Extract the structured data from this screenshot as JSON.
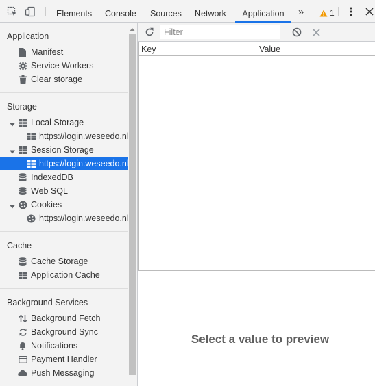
{
  "toolbar": {
    "tabs": [
      "Elements",
      "Console",
      "Sources",
      "Network",
      "Application"
    ],
    "active_tab": "Application",
    "warnings_count": "1",
    "accent": "#1a73e8",
    "warning_color": "#f29900"
  },
  "sidebar": {
    "application": {
      "title": "Application",
      "items": [
        "Manifest",
        "Service Workers",
        "Clear storage"
      ]
    },
    "storage": {
      "title": "Storage",
      "local_storage": "Local Storage",
      "local_storage_origin": "https://login.weseedo.nl",
      "session_storage": "Session Storage",
      "session_storage_origin": "https://login.weseedo.nl",
      "indexeddb": "IndexedDB",
      "websql": "Web SQL",
      "cookies": "Cookies",
      "cookies_origin": "https://login.weseedo.nl"
    },
    "cache": {
      "title": "Cache",
      "items": [
        "Cache Storage",
        "Application Cache"
      ]
    },
    "background": {
      "title": "Background Services",
      "items": [
        "Background Fetch",
        "Background Sync",
        "Notifications",
        "Payment Handler",
        "Push Messaging"
      ]
    }
  },
  "main": {
    "filter_placeholder": "Filter",
    "columns": [
      "Key",
      "Value"
    ],
    "preview_text": "Select a value to preview"
  }
}
